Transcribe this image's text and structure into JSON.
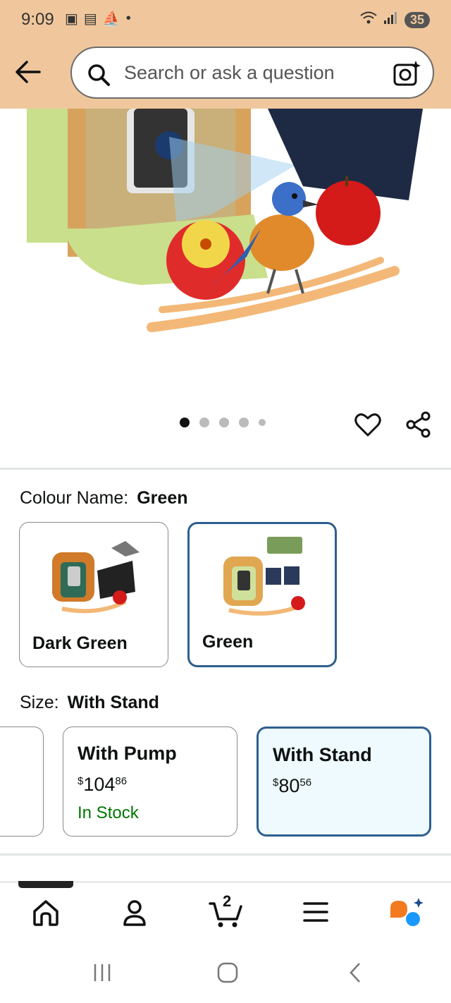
{
  "status_bar": {
    "time": "9:09",
    "battery": "35"
  },
  "search": {
    "placeholder": "Search or ask a question"
  },
  "gallery": {
    "dot_count": 5,
    "active_index": 0
  },
  "colour": {
    "label": "Colour Name:",
    "selected": "Green",
    "options": [
      {
        "name": "Dark Green",
        "selected": false
      },
      {
        "name": "Green",
        "selected": true
      }
    ]
  },
  "size": {
    "label": "Size:",
    "selected": "With Stand",
    "options": [
      {
        "name": "With Pump",
        "price_symbol": "$",
        "price_whole": "104",
        "price_fraction": "86",
        "stock": "In Stock",
        "selected": false
      },
      {
        "name": "With Stand",
        "price_symbol": "$",
        "price_whole": "80",
        "price_fraction": "56",
        "stock": "",
        "selected": true
      }
    ]
  },
  "bottom_nav": {
    "cart_count": "2"
  },
  "colors": {
    "header_bg": "#f0c79c",
    "selected_border": "#2e5f8f",
    "stock_green": "#007600",
    "rufus_orange": "#f47a1f",
    "rufus_blue": "#1a98ff"
  }
}
